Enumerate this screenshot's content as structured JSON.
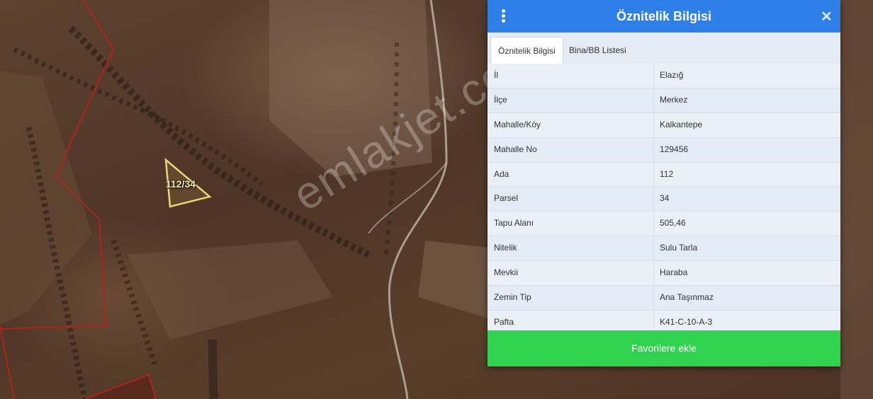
{
  "map": {
    "parcel_label": "112/34",
    "watermark": "emlakjet.com"
  },
  "panel": {
    "title": "Öznitelik Bilgisi",
    "tabs": [
      {
        "label": "Öznitelik Bilgisi",
        "active": true
      },
      {
        "label": "Bina/BB Listesi",
        "active": false
      }
    ],
    "rows": [
      {
        "key": "İl",
        "value": "Elazığ"
      },
      {
        "key": "İlçe",
        "value": "Merkez"
      },
      {
        "key": "Mahalle/Köy",
        "value": "Kalkantepe"
      },
      {
        "key": "Mahalle No",
        "value": "129456"
      },
      {
        "key": "Ada",
        "value": "112"
      },
      {
        "key": "Parsel",
        "value": "34"
      },
      {
        "key": "Tapu Alanı",
        "value": "505,46"
      },
      {
        "key": "Nitelik",
        "value": "Sulu Tarla"
      },
      {
        "key": "Mevkii",
        "value": "Haraba"
      },
      {
        "key": "Zemin Tip",
        "value": "Ana Taşınmaz"
      },
      {
        "key": "Pafta",
        "value": "K41-C-10-A-3"
      }
    ],
    "button_label": "Favorilere ekle"
  },
  "colors": {
    "header": "#2f7fe8",
    "button": "#2fd34e",
    "parcel_outline": "#e8d67a",
    "boundary": "#b0241a"
  }
}
